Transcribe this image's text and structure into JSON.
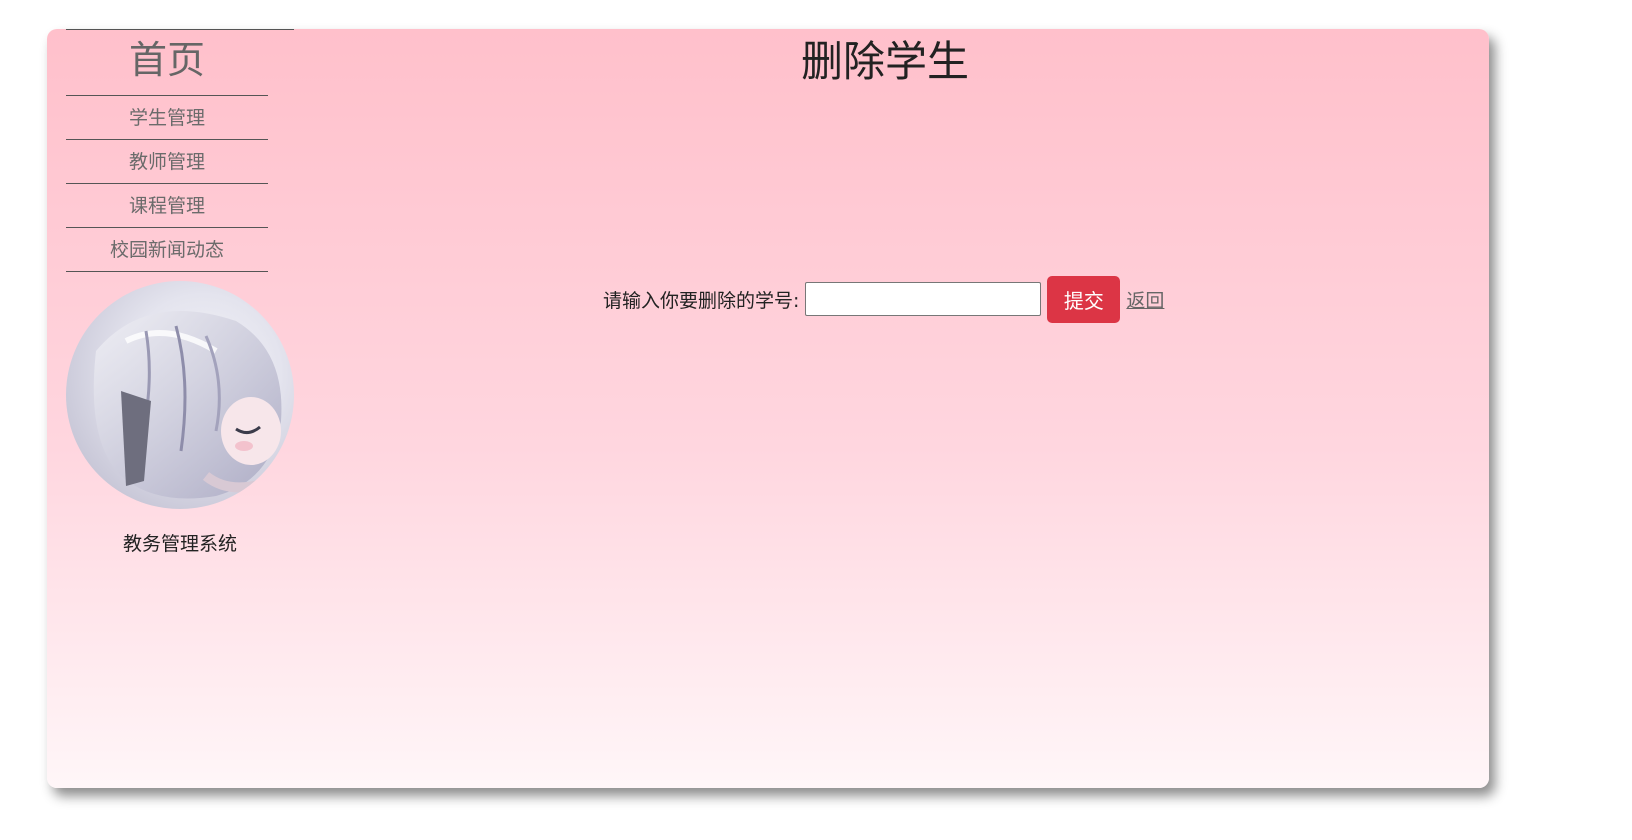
{
  "sidebar": {
    "home_label": "首页",
    "items": [
      {
        "label": "学生管理"
      },
      {
        "label": "教师管理"
      },
      {
        "label": "课程管理"
      },
      {
        "label": "校园新闻动态"
      }
    ],
    "system_name": "教务管理系统"
  },
  "main": {
    "title": "删除学生",
    "form": {
      "label": "请输入你要删除的学号:",
      "input_value": "",
      "submit_label": "提交",
      "back_label": "返回"
    }
  },
  "colors": {
    "card_gradient_top": "#ffc0cb",
    "card_gradient_bottom": "#fff6f8",
    "submit_button": "#dc3545"
  }
}
